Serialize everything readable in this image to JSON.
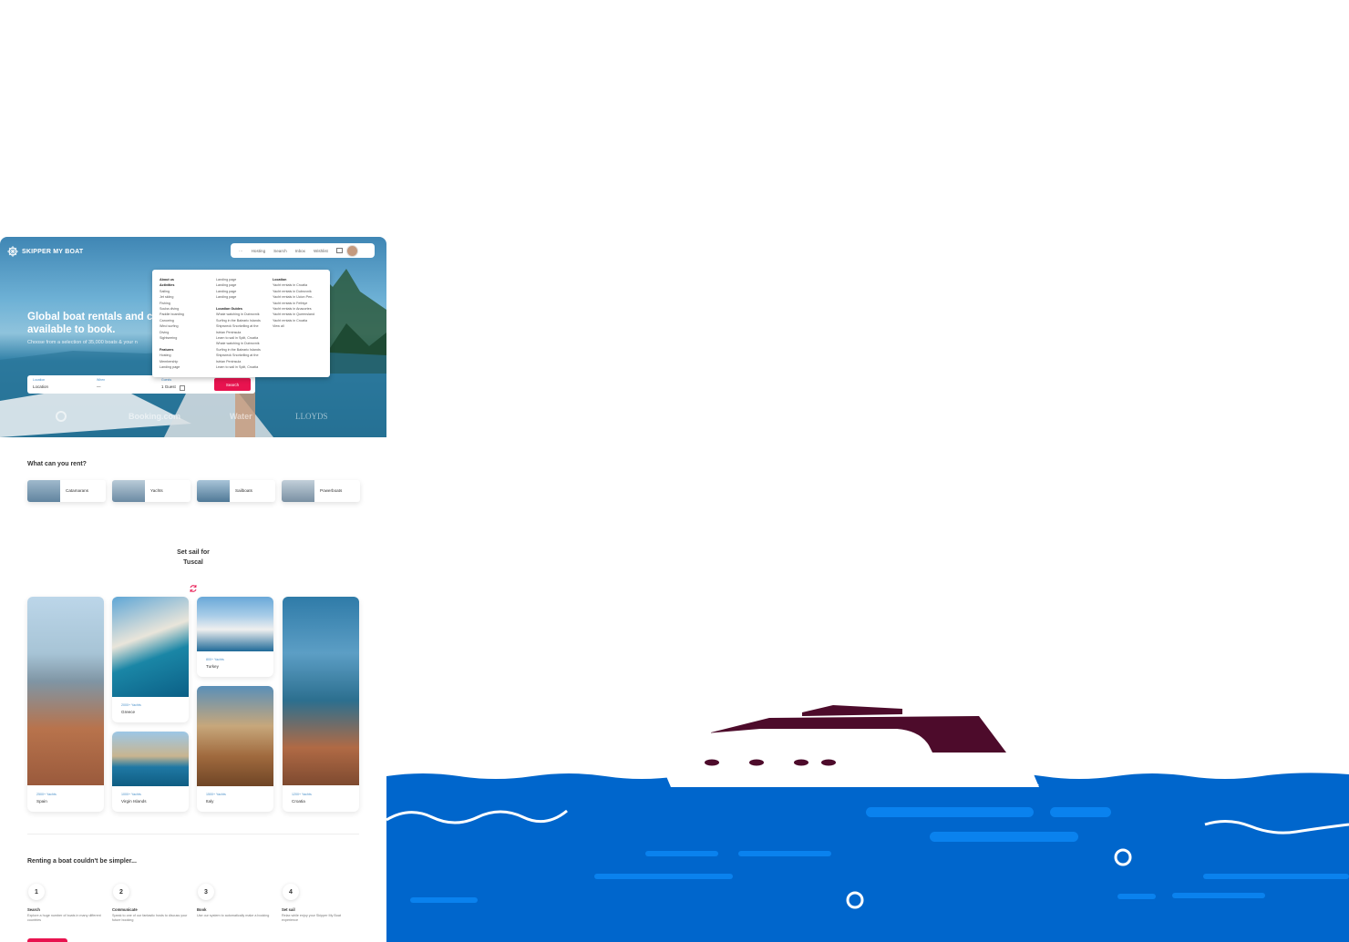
{
  "brand": {
    "name": "SKIPPER MY BOAT"
  },
  "nav": {
    "items": [
      "···",
      "Hosting",
      "Search",
      "Inbox",
      "Wishlist"
    ]
  },
  "hero": {
    "title_line1": "Global boat rentals and c",
    "title_line2": "available to book.",
    "subtitle": "Choose from a selection of 35,000 boats & your n"
  },
  "search": {
    "location_label": "Location",
    "location_value": "Location",
    "when_label": "When",
    "when_value": "—",
    "guests_label": "Guests",
    "guests_value": "1 Guest",
    "button_label": "Search"
  },
  "partners": [
    "Booking.com",
    "Water",
    "LLOYDS"
  ],
  "dropdown": {
    "col1": [
      {
        "text": "About us",
        "heading": true
      },
      {
        "text": "Activities",
        "heading": true
      },
      {
        "text": "Sailing"
      },
      {
        "text": "Jet skiing"
      },
      {
        "text": "Fishing"
      },
      {
        "text": "Scuba diving"
      },
      {
        "text": "Paddle boarding"
      },
      {
        "text": "Canoeing"
      },
      {
        "text": "Wind surfing"
      },
      {
        "text": "Diving"
      },
      {
        "text": "Sightseeing"
      },
      {
        "text": ""
      },
      {
        "text": "Features",
        "heading": true
      },
      {
        "text": "Hosting"
      },
      {
        "text": "Membership"
      },
      {
        "text": "Landing page"
      }
    ],
    "col2": [
      {
        "text": "Landing page"
      },
      {
        "text": "Landing page"
      },
      {
        "text": "Landing page"
      },
      {
        "text": "Landing page"
      },
      {
        "text": ""
      },
      {
        "text": "Location Guides",
        "heading": true
      },
      {
        "text": "Whale watching in Dubrovnik"
      },
      {
        "text": "Surfing in the Balearic Islands"
      },
      {
        "text": "Shipwreck Snorkelling at the"
      },
      {
        "text": "Istrian Peninsula"
      },
      {
        "text": "Learn to sail in Split, Croatia"
      },
      {
        "text": "Whale watching in Dubrovnik"
      },
      {
        "text": "Surfing in the Balearic Islands"
      },
      {
        "text": "Shipwreck Snorkelling at the"
      },
      {
        "text": "Istrian Peninsula"
      },
      {
        "text": "Learn to sail in Split, Croatia"
      }
    ],
    "col3": [
      {
        "text": "Location",
        "heading": true
      },
      {
        "text": "Yacht rentals in Croatia"
      },
      {
        "text": "Yacht rentals in Dubrovnik"
      },
      {
        "text": "Yacht rentals in Ucion Pen.."
      },
      {
        "text": "Yacht rentals in Fethiye"
      },
      {
        "text": "Yacht rentals in Anacortes"
      },
      {
        "text": "Yacht rentals in Queensland"
      },
      {
        "text": "Yacht rentals in Croatia"
      },
      {
        "text": "View all"
      }
    ]
  },
  "rent": {
    "heading": "What can you rent?",
    "categories": [
      "Catamarans",
      "Yachts",
      "Sailboats",
      "Powerboats"
    ]
  },
  "setsail": {
    "line1": "Set sail for",
    "line2": "Tuscal"
  },
  "destinations": [
    {
      "name": "Spain",
      "count": "2500+ Yachts"
    },
    {
      "name": "Greece",
      "count": "2000+ Yachts"
    },
    {
      "name": "Virgin Islands",
      "count": "1000+ Yachts"
    },
    {
      "name": "Turkey",
      "count": "800+ Yachts"
    },
    {
      "name": "Italy",
      "count": "1500+ Yachts"
    },
    {
      "name": "Croatia",
      "count": "1200+ Yachts"
    }
  ],
  "steps": {
    "heading": "Renting a boat couldn't be simpler...",
    "items": [
      {
        "num": "1",
        "title": "Search",
        "desc": "Explore a huge number of boats in many different countries"
      },
      {
        "num": "2",
        "title": "Communicate",
        "desc": "Speak to one of our fantastic hosts to discuss your future booking"
      },
      {
        "num": "3",
        "title": "Book",
        "desc": "Use our system to automatically make a booking"
      },
      {
        "num": "4",
        "title": "Set sail",
        "desc": "Relax while enjoy your Skipper My Boat experience"
      }
    ]
  },
  "colors": {
    "accent": "#e8134f",
    "link_blue": "#4a90c9",
    "sea": "#0066cc",
    "sea_stripe": "#0a82ee",
    "hull": "#ffffff",
    "cabin": "#4d0b2b"
  }
}
